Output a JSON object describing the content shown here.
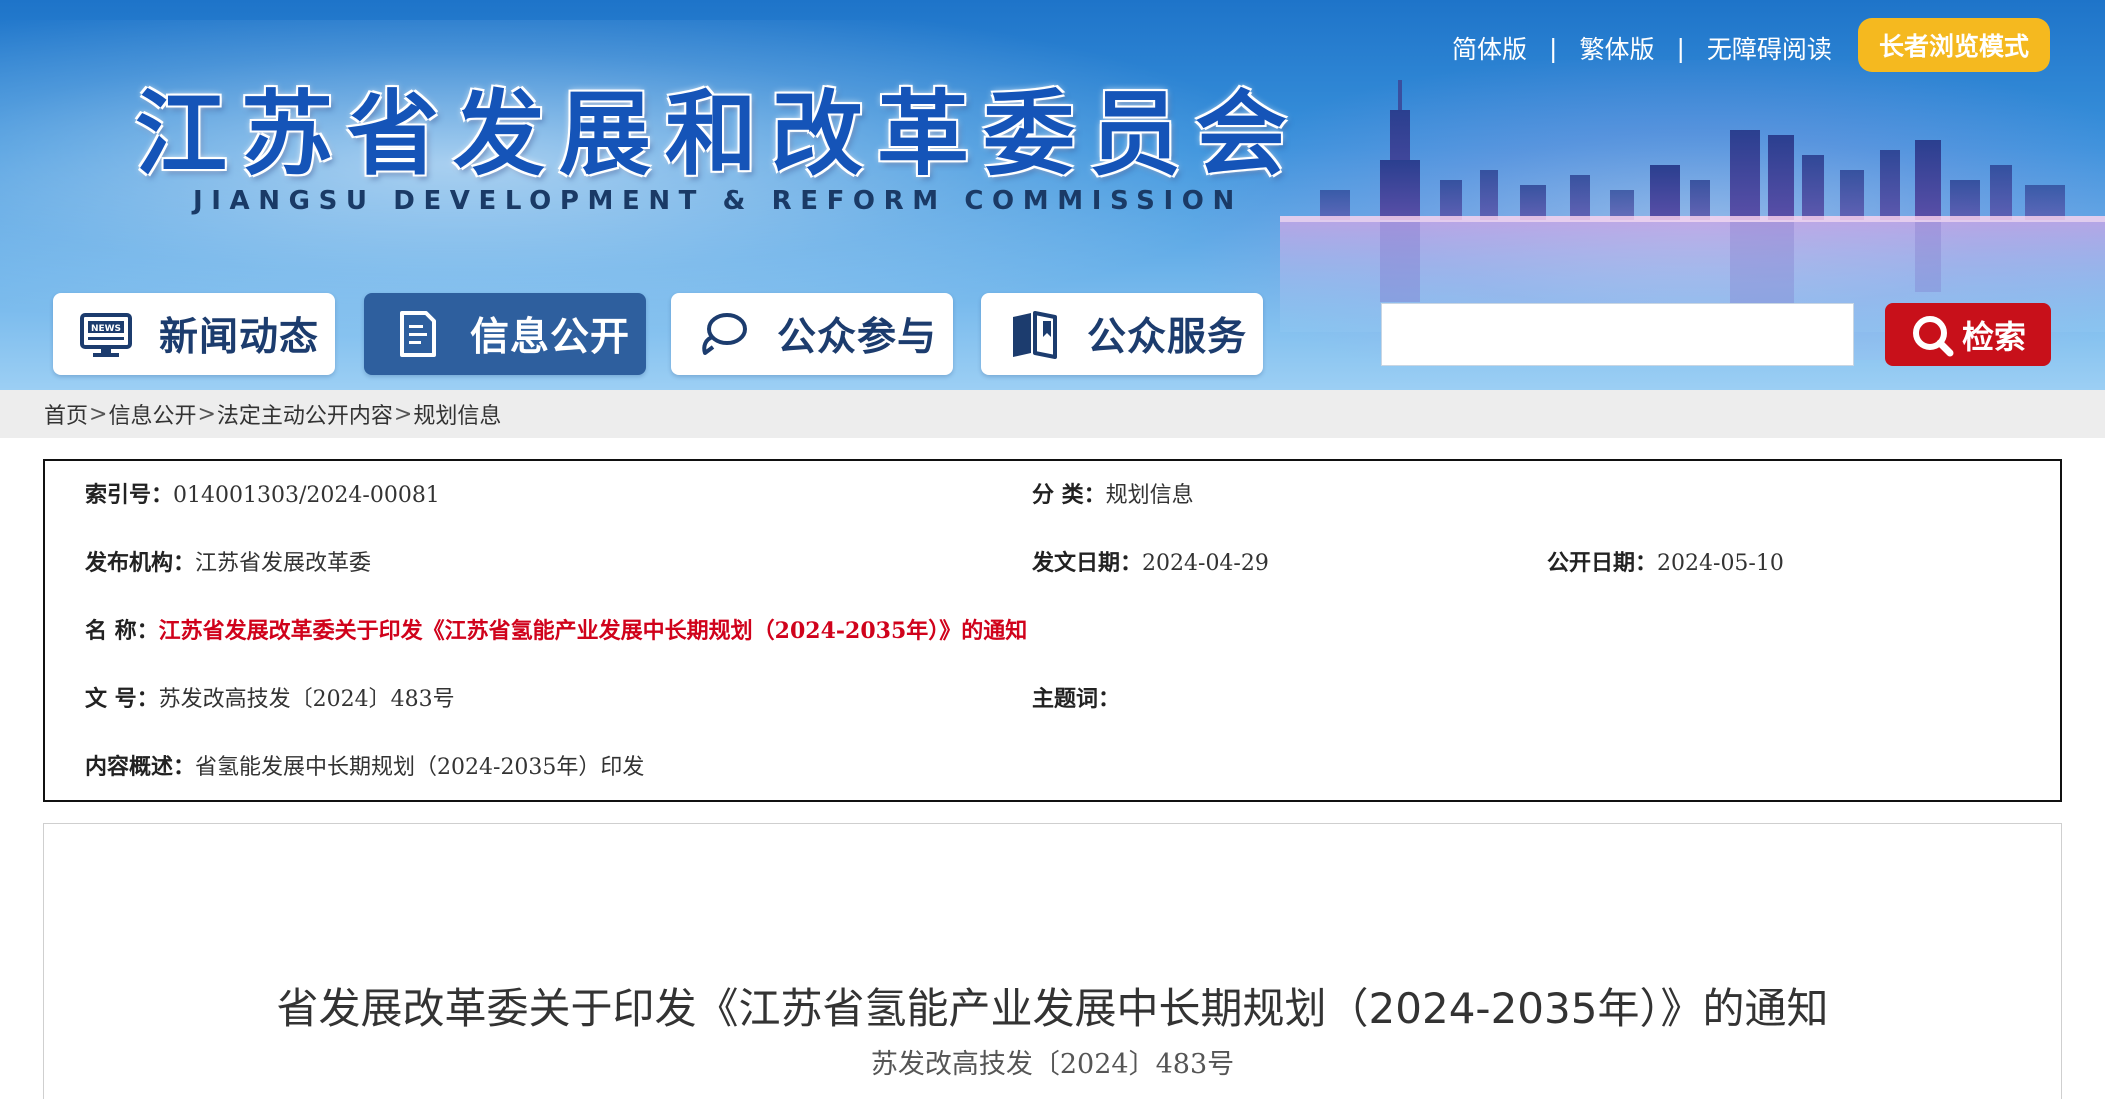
{
  "header": {
    "title": "江苏省发展和改革委员会",
    "subtitle": "JIANGSU DEVELOPMENT & REFORM COMMISSION",
    "top_links": [
      "简体版",
      "繁体版",
      "无障碍阅读"
    ],
    "separator": "|",
    "elder_mode": "长者浏览模式"
  },
  "nav": {
    "items": [
      {
        "label": "新闻动态",
        "icon": "news-icon"
      },
      {
        "label": "信息公开",
        "icon": "document-icon"
      },
      {
        "label": "公众参与",
        "icon": "chat-icon"
      },
      {
        "label": "公众服务",
        "icon": "book-icon"
      }
    ],
    "active_index": 1
  },
  "search": {
    "placeholder": "",
    "button_label": "检索"
  },
  "breadcrumb": {
    "items": [
      "首页",
      "信息公开",
      "法定主动公开内容",
      "规划信息"
    ],
    "separator": ">"
  },
  "meta": {
    "index_no": {
      "label": "索引号：",
      "value": "014001303/2024-00081"
    },
    "category": {
      "label": "分  类：",
      "value": "规划信息"
    },
    "publisher": {
      "label": "发布机构：",
      "value": "江苏省发展改革委"
    },
    "issue_date": {
      "label": "发文日期：",
      "value": "2024-04-29"
    },
    "public_date": {
      "label": "公开日期：",
      "value": "2024-05-10"
    },
    "name": {
      "label": "名  称：",
      "value": "江苏省发展改革委关于印发《江苏省氢能产业发展中长期规划（2024-2035年）》的通知"
    },
    "doc_no": {
      "label": "文  号：",
      "value": "苏发改高技发〔2024〕483号"
    },
    "keywords": {
      "label": "主题词：",
      "value": ""
    },
    "summary": {
      "label": "内容概述：",
      "value": "省氢能发展中长期规划（2024-2035年）印发"
    }
  },
  "article": {
    "title": "省发展改革委关于印发《江苏省氢能产业发展中长期规划（2024-2035年）》的通知",
    "doc_no": "苏发改高技发〔2024〕483号"
  },
  "colors": {
    "header_blue": "#1e74c9",
    "title_blue": "#1554b8",
    "nav_active": "#2e5f9e",
    "elder_btn": "#f5b91f",
    "search_btn": "#c8101a",
    "highlight_red": "#d0021b"
  }
}
